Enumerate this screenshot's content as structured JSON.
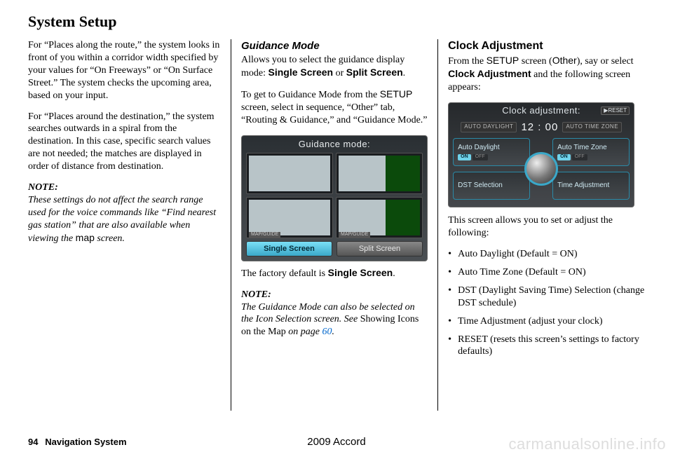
{
  "page": {
    "title": "System Setup",
    "number": "94",
    "section_label": "Navigation System",
    "footer_center": "2009  Accord",
    "watermark": "carmanualsonline.info"
  },
  "col1": {
    "p1": "For “Places along the route,” the system looks in front of you within a corridor width specified by your values for “On Freeways” or “On Surface Street.” The system checks the upcoming area, based on your input.",
    "p2": "For “Places around the destination,” the system searches outwards in a spiral from the destination. In this case, specific search values are not needed; the matches are displayed in order of distance from destination.",
    "note_label": "NOTE:",
    "note_body_1": "These settings do not affect the search range used for the voice commands like “Find nearest gas station” that are also available when viewing the ",
    "note_body_map": "map",
    "note_body_2": " screen."
  },
  "col2": {
    "heading": "Guidance Mode",
    "p1a": "Allows you to select the guidance display mode: ",
    "p1b_single": "Single Screen",
    "p1c": " or ",
    "p1d_split": "Split Screen",
    "p1e": ".",
    "p2a": "To get to Guidance Mode from the ",
    "p2b_setup": "SETUP",
    "p2c": " screen, select in sequence, “Other” tab, “Routing & Guidance,” and “Guidance Mode.”",
    "fig": {
      "title": "Guidance mode:",
      "tab_label": "MAP/GUIDE",
      "btn_single": "Single Screen",
      "btn_split": "Split Screen"
    },
    "caption_a": "The factory default is ",
    "caption_b": "Single Screen",
    "caption_c": ".",
    "note_label": "NOTE:",
    "note_body_1": "The Guidance Mode can also be selected on the Icon Selection screen. See ",
    "note_body_link_pre": "Showing Icons on the Map",
    "note_body_2": " on page ",
    "note_body_pg": "60",
    "note_body_3": "."
  },
  "col3": {
    "heading": "Clock Adjustment",
    "p1a": "From the ",
    "p1b_setup": "SETUP",
    "p1c": " screen (",
    "p1d_other": "Other",
    "p1e": "), say or select ",
    "p1f_ca": "Clock Adjustment",
    "p1g": " and the following screen appears:",
    "fig": {
      "title": "Clock adjustment:",
      "reset": "▶RESET",
      "pill_left": "AUTO DAYLIGHT",
      "time": "12 : 00",
      "pill_right": "AUTO TIME ZONE",
      "q_tl": "Auto Daylight",
      "q_tr": "Auto Time Zone",
      "q_bl": "DST Selection",
      "q_br": "Time Adjustment",
      "on": "ON",
      "off": "OFF"
    },
    "p2": "This screen allows you to set or adjust the following:",
    "bullets": [
      "Auto Daylight (Default = ON)",
      "Auto Time Zone (Default = ON)",
      "DST (Daylight Saving Time) Selection (change DST schedule)",
      "Time Adjustment (adjust your clock)",
      "RESET (resets this screen’s settings to factory defaults)"
    ]
  }
}
